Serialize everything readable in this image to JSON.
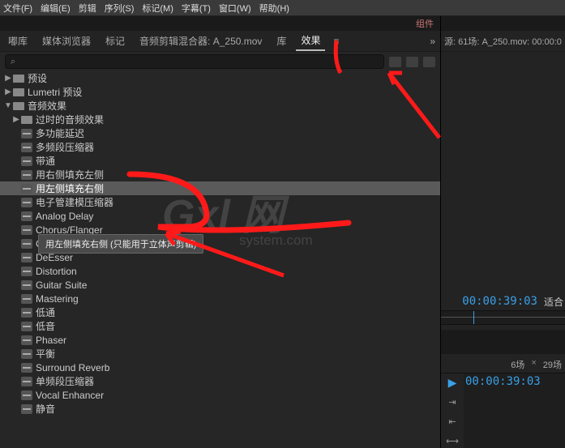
{
  "menubar": [
    "文件(F)",
    "编辑(E)",
    "剪辑",
    "序列(S)",
    "标记(M)",
    "字幕(T)",
    "窗口(W)",
    "帮助(H)"
  ],
  "top_right_tab": "组件",
  "panel_tabs": {
    "items": [
      "嘟库",
      "媒体浏览器",
      "标记",
      "音频剪辑混合器: A_250.mov",
      "库",
      "效果"
    ],
    "active_index": 5,
    "menu_glyph": "≡",
    "collapse_glyph": "»"
  },
  "search": {
    "glyph": "⌕"
  },
  "tree": [
    {
      "lvl": 0,
      "type": "folder",
      "caret": "▶",
      "label": "预设"
    },
    {
      "lvl": 0,
      "type": "folder",
      "caret": "▶",
      "label": "Lumetri 预设"
    },
    {
      "lvl": 0,
      "type": "folder",
      "caret": "▼",
      "label": "音频效果"
    },
    {
      "lvl": 1,
      "type": "folder",
      "caret": "▶",
      "label": "过时的音频效果"
    },
    {
      "lvl": 1,
      "type": "fx",
      "caret": "",
      "label": "多功能延迟"
    },
    {
      "lvl": 1,
      "type": "fx",
      "caret": "",
      "label": "多频段压缩器"
    },
    {
      "lvl": 1,
      "type": "fx",
      "caret": "",
      "label": "带通"
    },
    {
      "lvl": 1,
      "type": "fx",
      "caret": "",
      "label": "用右侧填充左侧"
    },
    {
      "lvl": 1,
      "type": "fx",
      "caret": "",
      "label": "用左侧填充右侧",
      "selected": true
    },
    {
      "lvl": 1,
      "type": "fx",
      "caret": "",
      "label": "电子管建模压缩器"
    },
    {
      "lvl": 1,
      "type": "fx",
      "caret": "",
      "label": "Analog Delay"
    },
    {
      "lvl": 1,
      "type": "fx",
      "caret": "",
      "label": "Chorus/Flanger"
    },
    {
      "lvl": 1,
      "type": "fx",
      "caret": "",
      "label": "Convolution Reverb"
    },
    {
      "lvl": 1,
      "type": "fx",
      "caret": "",
      "label": "DeEsser"
    },
    {
      "lvl": 1,
      "type": "fx",
      "caret": "",
      "label": "Distortion"
    },
    {
      "lvl": 1,
      "type": "fx",
      "caret": "",
      "label": "Guitar Suite"
    },
    {
      "lvl": 1,
      "type": "fx",
      "caret": "",
      "label": "Mastering"
    },
    {
      "lvl": 1,
      "type": "fx",
      "caret": "",
      "label": "低通"
    },
    {
      "lvl": 1,
      "type": "fx",
      "caret": "",
      "label": "低音"
    },
    {
      "lvl": 1,
      "type": "fx",
      "caret": "",
      "label": "Phaser"
    },
    {
      "lvl": 1,
      "type": "fx",
      "caret": "",
      "label": "平衡"
    },
    {
      "lvl": 1,
      "type": "fx",
      "caret": "",
      "label": "Surround Reverb"
    },
    {
      "lvl": 1,
      "type": "fx",
      "caret": "",
      "label": "单频段压缩器"
    },
    {
      "lvl": 1,
      "type": "fx",
      "caret": "",
      "label": "Vocal Enhancer"
    },
    {
      "lvl": 1,
      "type": "fx",
      "caret": "",
      "label": "静音"
    }
  ],
  "tooltip": "用左侧填充右侧 (只能用于立体声剪辑)",
  "watermark": {
    "main": "Gxl 网",
    "sub": "system.com"
  },
  "right": {
    "source_tab": "源: 61场: A_250.mov: 00:00:0",
    "timecode1": "00:00:39:03",
    "fit": "适合",
    "timeline_tabs": {
      "left": "6场",
      "close": "×",
      "right": "29场"
    },
    "timecode2": "00:00:39:03"
  }
}
